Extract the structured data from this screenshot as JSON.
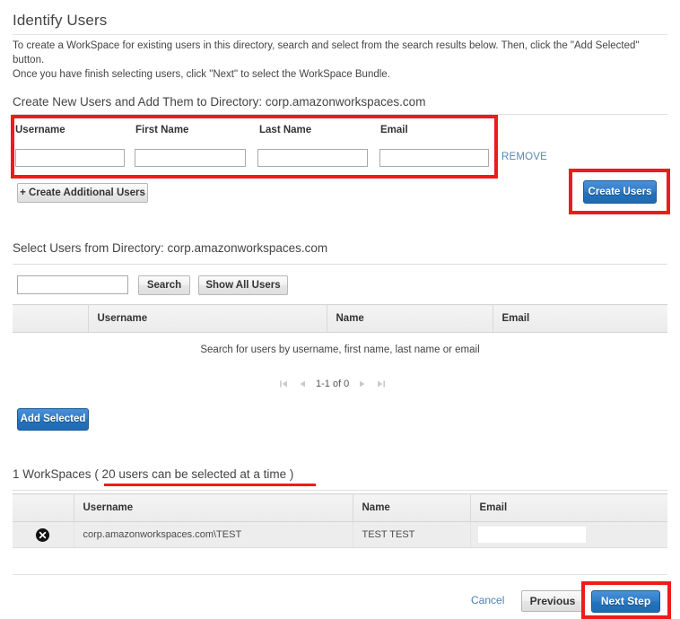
{
  "header": {
    "title": "Identify Users",
    "intro_line1": "To create a WorkSpace for existing users in this directory, search and select from the search results below. Then, click the \"Add Selected\" button.",
    "intro_line2": "Once you have finish selecting users, click \"Next\" to select the WorkSpace Bundle."
  },
  "create_section": {
    "heading": "Create New Users and Add Them to Directory: corp.amazonworkspaces.com",
    "columns": {
      "username": "Username",
      "first_name": "First Name",
      "last_name": "Last Name",
      "email": "Email"
    },
    "values": {
      "username": "",
      "first_name": "",
      "last_name": "",
      "email": ""
    },
    "remove_label": "REMOVE",
    "add_row_label": "+ Create Additional Users",
    "create_users_label": "Create Users"
  },
  "select_section": {
    "heading": "Select Users from Directory: corp.amazonworkspaces.com",
    "search_value": "",
    "search_button": "Search",
    "show_all_button": "Show All Users",
    "columns": [
      "",
      "Username",
      "Name",
      "Email"
    ],
    "empty_hint": "Search for users by username, first name, last name or email",
    "pagination": {
      "first_icon": "first-page-icon",
      "prev_icon": "previous-page-icon",
      "range_text": "1-1 of 0",
      "next_icon": "next-page-icon",
      "last_icon": "last-page-icon"
    },
    "add_selected_label": "Add Selected"
  },
  "workspaces_section": {
    "count_label": "1 WorkSpaces",
    "note_label": "( 20 users can be selected at a time )",
    "columns": [
      "",
      "Username",
      "Name",
      "Email"
    ],
    "rows": [
      {
        "remove_icon": "remove-circle-icon",
        "username": "corp.amazonworkspaces.com\\TEST",
        "name": "TEST TEST",
        "email": ""
      }
    ]
  },
  "footer": {
    "cancel_label": "Cancel",
    "previous_label": "Previous",
    "next_step_label": "Next Step"
  },
  "colors": {
    "highlight_red": "#ee1b1b",
    "primary_blue": "#2573bd",
    "link_blue": "#5a87b0"
  }
}
